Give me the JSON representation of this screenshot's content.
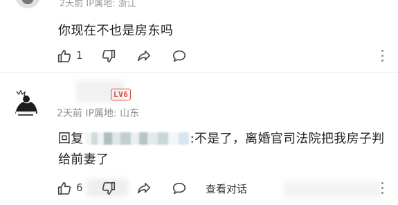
{
  "comment1": {
    "meta": "2天前 IP属地: 浙江",
    "text": "你现在不也是房东吗",
    "likes": "1"
  },
  "comment2": {
    "level": "LV6",
    "meta": "2天前 IP属地: 山东",
    "reply_prefix": "回复",
    "reply_body": ":不是了，离婚官司法院把我房子判给前妻了",
    "likes": "6",
    "view_reply_label": "查看对话"
  },
  "icons": [
    "like-icon",
    "dislike-icon",
    "share-icon",
    "comment-icon",
    "more-icon"
  ],
  "colors": {
    "level_badge": "#e0463c",
    "meta_text": "#8e8e8e",
    "body_text": "#222222"
  }
}
